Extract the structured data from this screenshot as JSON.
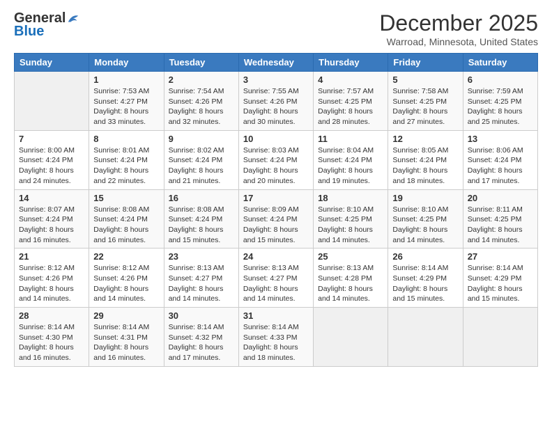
{
  "logo": {
    "general": "General",
    "blue": "Blue"
  },
  "title": "December 2025",
  "location": "Warroad, Minnesota, United States",
  "days_header": [
    "Sunday",
    "Monday",
    "Tuesday",
    "Wednesday",
    "Thursday",
    "Friday",
    "Saturday"
  ],
  "weeks": [
    [
      {
        "day": "",
        "sunrise": "",
        "sunset": "",
        "daylight": ""
      },
      {
        "day": "1",
        "sunrise": "Sunrise: 7:53 AM",
        "sunset": "Sunset: 4:27 PM",
        "daylight": "Daylight: 8 hours and 33 minutes."
      },
      {
        "day": "2",
        "sunrise": "Sunrise: 7:54 AM",
        "sunset": "Sunset: 4:26 PM",
        "daylight": "Daylight: 8 hours and 32 minutes."
      },
      {
        "day": "3",
        "sunrise": "Sunrise: 7:55 AM",
        "sunset": "Sunset: 4:26 PM",
        "daylight": "Daylight: 8 hours and 30 minutes."
      },
      {
        "day": "4",
        "sunrise": "Sunrise: 7:57 AM",
        "sunset": "Sunset: 4:25 PM",
        "daylight": "Daylight: 8 hours and 28 minutes."
      },
      {
        "day": "5",
        "sunrise": "Sunrise: 7:58 AM",
        "sunset": "Sunset: 4:25 PM",
        "daylight": "Daylight: 8 hours and 27 minutes."
      },
      {
        "day": "6",
        "sunrise": "Sunrise: 7:59 AM",
        "sunset": "Sunset: 4:25 PM",
        "daylight": "Daylight: 8 hours and 25 minutes."
      }
    ],
    [
      {
        "day": "7",
        "sunrise": "Sunrise: 8:00 AM",
        "sunset": "Sunset: 4:24 PM",
        "daylight": "Daylight: 8 hours and 24 minutes."
      },
      {
        "day": "8",
        "sunrise": "Sunrise: 8:01 AM",
        "sunset": "Sunset: 4:24 PM",
        "daylight": "Daylight: 8 hours and 22 minutes."
      },
      {
        "day": "9",
        "sunrise": "Sunrise: 8:02 AM",
        "sunset": "Sunset: 4:24 PM",
        "daylight": "Daylight: 8 hours and 21 minutes."
      },
      {
        "day": "10",
        "sunrise": "Sunrise: 8:03 AM",
        "sunset": "Sunset: 4:24 PM",
        "daylight": "Daylight: 8 hours and 20 minutes."
      },
      {
        "day": "11",
        "sunrise": "Sunrise: 8:04 AM",
        "sunset": "Sunset: 4:24 PM",
        "daylight": "Daylight: 8 hours and 19 minutes."
      },
      {
        "day": "12",
        "sunrise": "Sunrise: 8:05 AM",
        "sunset": "Sunset: 4:24 PM",
        "daylight": "Daylight: 8 hours and 18 minutes."
      },
      {
        "day": "13",
        "sunrise": "Sunrise: 8:06 AM",
        "sunset": "Sunset: 4:24 PM",
        "daylight": "Daylight: 8 hours and 17 minutes."
      }
    ],
    [
      {
        "day": "14",
        "sunrise": "Sunrise: 8:07 AM",
        "sunset": "Sunset: 4:24 PM",
        "daylight": "Daylight: 8 hours and 16 minutes."
      },
      {
        "day": "15",
        "sunrise": "Sunrise: 8:08 AM",
        "sunset": "Sunset: 4:24 PM",
        "daylight": "Daylight: 8 hours and 16 minutes."
      },
      {
        "day": "16",
        "sunrise": "Sunrise: 8:08 AM",
        "sunset": "Sunset: 4:24 PM",
        "daylight": "Daylight: 8 hours and 15 minutes."
      },
      {
        "day": "17",
        "sunrise": "Sunrise: 8:09 AM",
        "sunset": "Sunset: 4:24 PM",
        "daylight": "Daylight: 8 hours and 15 minutes."
      },
      {
        "day": "18",
        "sunrise": "Sunrise: 8:10 AM",
        "sunset": "Sunset: 4:25 PM",
        "daylight": "Daylight: 8 hours and 14 minutes."
      },
      {
        "day": "19",
        "sunrise": "Sunrise: 8:10 AM",
        "sunset": "Sunset: 4:25 PM",
        "daylight": "Daylight: 8 hours and 14 minutes."
      },
      {
        "day": "20",
        "sunrise": "Sunrise: 8:11 AM",
        "sunset": "Sunset: 4:25 PM",
        "daylight": "Daylight: 8 hours and 14 minutes."
      }
    ],
    [
      {
        "day": "21",
        "sunrise": "Sunrise: 8:12 AM",
        "sunset": "Sunset: 4:26 PM",
        "daylight": "Daylight: 8 hours and 14 minutes."
      },
      {
        "day": "22",
        "sunrise": "Sunrise: 8:12 AM",
        "sunset": "Sunset: 4:26 PM",
        "daylight": "Daylight: 8 hours and 14 minutes."
      },
      {
        "day": "23",
        "sunrise": "Sunrise: 8:13 AM",
        "sunset": "Sunset: 4:27 PM",
        "daylight": "Daylight: 8 hours and 14 minutes."
      },
      {
        "day": "24",
        "sunrise": "Sunrise: 8:13 AM",
        "sunset": "Sunset: 4:27 PM",
        "daylight": "Daylight: 8 hours and 14 minutes."
      },
      {
        "day": "25",
        "sunrise": "Sunrise: 8:13 AM",
        "sunset": "Sunset: 4:28 PM",
        "daylight": "Daylight: 8 hours and 14 minutes."
      },
      {
        "day": "26",
        "sunrise": "Sunrise: 8:14 AM",
        "sunset": "Sunset: 4:29 PM",
        "daylight": "Daylight: 8 hours and 15 minutes."
      },
      {
        "day": "27",
        "sunrise": "Sunrise: 8:14 AM",
        "sunset": "Sunset: 4:29 PM",
        "daylight": "Daylight: 8 hours and 15 minutes."
      }
    ],
    [
      {
        "day": "28",
        "sunrise": "Sunrise: 8:14 AM",
        "sunset": "Sunset: 4:30 PM",
        "daylight": "Daylight: 8 hours and 16 minutes."
      },
      {
        "day": "29",
        "sunrise": "Sunrise: 8:14 AM",
        "sunset": "Sunset: 4:31 PM",
        "daylight": "Daylight: 8 hours and 16 minutes."
      },
      {
        "day": "30",
        "sunrise": "Sunrise: 8:14 AM",
        "sunset": "Sunset: 4:32 PM",
        "daylight": "Daylight: 8 hours and 17 minutes."
      },
      {
        "day": "31",
        "sunrise": "Sunrise: 8:14 AM",
        "sunset": "Sunset: 4:33 PM",
        "daylight": "Daylight: 8 hours and 18 minutes."
      },
      {
        "day": "",
        "sunrise": "",
        "sunset": "",
        "daylight": ""
      },
      {
        "day": "",
        "sunrise": "",
        "sunset": "",
        "daylight": ""
      },
      {
        "day": "",
        "sunrise": "",
        "sunset": "",
        "daylight": ""
      }
    ]
  ]
}
